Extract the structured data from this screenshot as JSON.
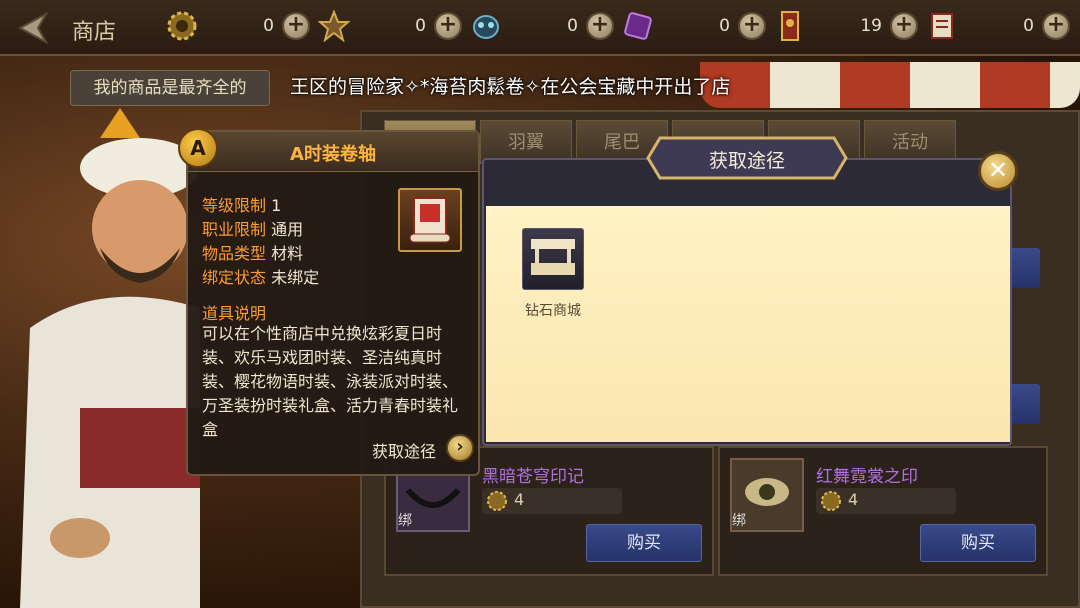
{
  "header": {
    "title": "商店",
    "currencies": [
      {
        "icon": "gold-gear-coin-icon",
        "value": "0"
      },
      {
        "icon": "star-medal-icon",
        "value": "0"
      },
      {
        "icon": "demon-mask-icon",
        "value": "0"
      },
      {
        "icon": "purple-crystal-icon",
        "value": "0"
      },
      {
        "icon": "guild-banner-icon",
        "value": "19"
      },
      {
        "icon": "scroll-ticket-icon",
        "value": "0"
      }
    ]
  },
  "merchant_speech": "我的商品是最齐全的",
  "ticker": "王区的冒险家✧*海苔肉鬆卷✧在公会宝藏中开出了店",
  "tabs": [
    "",
    "羽翼",
    "尾巴",
    "",
    "",
    "活动"
  ],
  "cards": [
    {
      "name": "黑暗苍穹印记",
      "price": "4",
      "bind": "绑",
      "buy": "购买"
    },
    {
      "name": "红舞霓裳之印",
      "price": "4",
      "bind": "绑",
      "buy": "购买"
    }
  ],
  "tooltip": {
    "badge": "A",
    "title": "A时装卷轴",
    "rows": [
      {
        "key": "等级限制",
        "value": "1"
      },
      {
        "key": "职业限制",
        "value": "通用"
      },
      {
        "key": "物品类型",
        "value": "材料"
      },
      {
        "key": "绑定状态",
        "value": "未绑定"
      }
    ],
    "desc_title": "道具说明",
    "desc": "可以在个性商店中兑换炫彩夏日时装、欢乐马戏团时装、圣洁纯真时装、樱花物语时装、泳装派对时装、万圣装扮时装礼盒、活力青春时装礼盒",
    "source_label": "获取途径"
  },
  "dialog": {
    "title": "获取途径",
    "sources": [
      {
        "label": "钻石商城",
        "icon": "shop-stall-icon"
      }
    ]
  },
  "colors": {
    "accent_orange": "#ff9a2e",
    "title_gold": "#ffb340",
    "purple_name": "#b071e0",
    "buy_blue": "#26336a",
    "dialog_body": "#fff2c4"
  }
}
